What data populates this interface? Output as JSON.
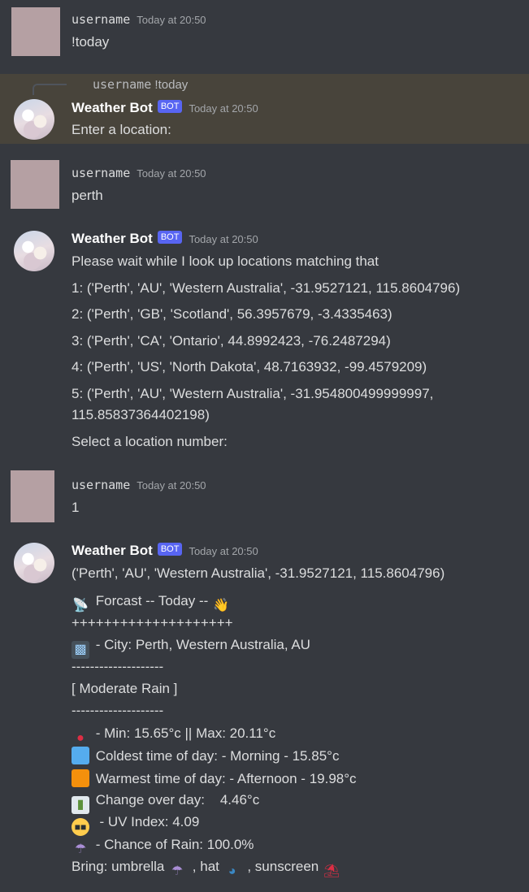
{
  "messages": {
    "m1": {
      "author": "username",
      "time": "Today at 20:50",
      "text": "!today"
    },
    "m2": {
      "reply_author": "username",
      "reply_text": "!today",
      "author": "Weather Bot",
      "badge": "BOT",
      "time": "Today at 20:50",
      "text": "Enter a location:"
    },
    "m3": {
      "author": "username",
      "time": "Today at 20:50",
      "text": "perth"
    },
    "m4": {
      "author": "Weather Bot",
      "badge": "BOT",
      "time": "Today at 20:50",
      "lines": [
        "Please wait while I look up locations matching that",
        "1: ('Perth', 'AU', 'Western Australia', -31.9527121, 115.8604796)",
        "2: ('Perth', 'GB', 'Scotland', 56.3957679, -3.4335463)",
        "3: ('Perth', 'CA', 'Ontario', 44.8992423, -76.2487294)",
        "4: ('Perth', 'US', 'North Dakota', 48.7163932, -99.4579209)",
        "5: ('Perth', 'AU', 'Western Australia', -31.954800499999997,",
        "115.85837364402198)",
        "Select a location number:"
      ]
    },
    "m5": {
      "author": "username",
      "time": "Today at 20:50",
      "text": "1"
    },
    "m6": {
      "author": "Weather Bot",
      "badge": "BOT",
      "time": "Today at 20:50",
      "location": "('Perth', 'AU', 'Western Australia', -31.9527121, 115.8604796)",
      "forecast": "Forcast -- Today --",
      "plus_line": "++++++++++++++++++++",
      "city": "- City: Perth, Western Australia, AU",
      "dash_line": "--------------------",
      "condition": "[ Moderate Rain ]",
      "dash_line2": "--------------------",
      "minmax": "- Min: 15.65°c || Max: 20.11°c",
      "coldest": "Coldest time of day: - Morning - 15.85°c",
      "warmest": "Warmest time of day: - Afternoon - 19.98°c",
      "change": "Change over day:    4.46°c",
      "uv": " - UV Index: 4.09",
      "rain": "- Chance of Rain: 100.0%",
      "bring_prefix": "Bring: umbrella",
      "bring_hat": ", hat",
      "bring_sun": ", sunscreen"
    }
  },
  "icons": {
    "dish": "satellite-dish-icon",
    "wave": "waving-hand-icon",
    "city": "night-city-icon",
    "therm": "thermometer-icon",
    "cold": "blue-square-icon",
    "warm": "orange-square-icon",
    "chart": "bar-chart-icon",
    "uv": "sunglasses-face-icon",
    "rain": "umbrella-rain-icon",
    "hat": "cap-icon",
    "beach": "beach-umbrella-icon"
  }
}
